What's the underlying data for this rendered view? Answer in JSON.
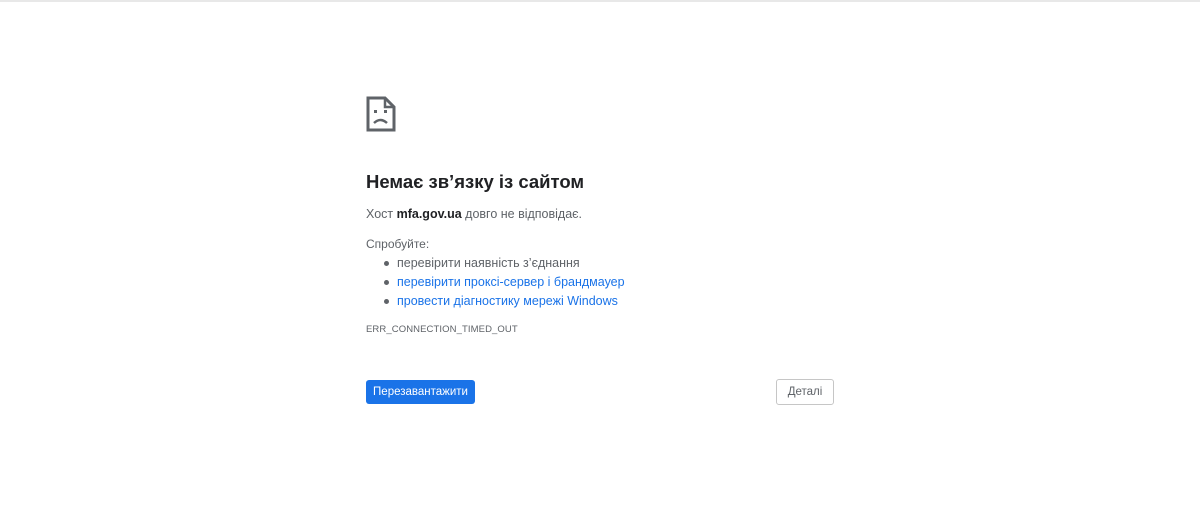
{
  "error_page": {
    "icon": "sad-page-icon",
    "title": "Немає зв’язку із сайтом",
    "host_prefix": "Хост ",
    "host": "mfa.gov.ua",
    "host_suffix": " довго не відповідає.",
    "try_label": "Спробуйте:",
    "suggestions": [
      {
        "text": "перевірити наявність з’єднання",
        "is_link": false
      },
      {
        "text": "перевірити проксі-сервер і брандмауер",
        "is_link": true
      },
      {
        "text": "провести діагностику мережі Windows",
        "is_link": true
      }
    ],
    "error_code": "ERR_CONNECTION_TIMED_OUT",
    "reload_label": "Перезавантажити",
    "details_label": "Деталі"
  },
  "colors": {
    "accent": "#1a73e8",
    "text": "#202124",
    "secondary_text": "#5f6368"
  }
}
